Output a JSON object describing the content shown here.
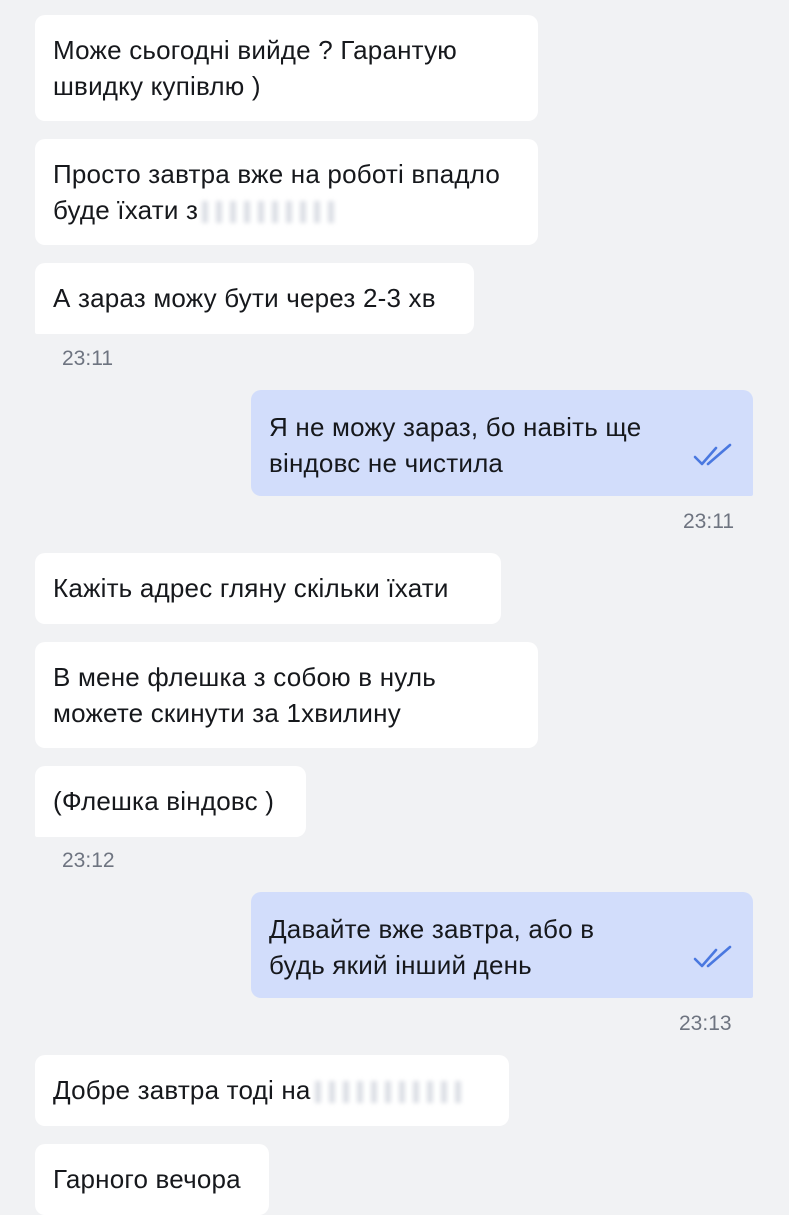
{
  "messages": {
    "m1": "Може сьогодні вийде ? Гарантую швидку купівлю )",
    "m2": "Просто завтра вже на роботі впадло буде їхати з",
    "m3": "А зараз можу бути через 2-3 хв",
    "t1": "23:11",
    "m4": "Я не можу зараз, бо навіть ще віндовс не чистила",
    "t2": "23:11",
    "m5": "Кажіть адрес гляну скільки їхати",
    "m6": "В мене флешка з собою в нуль можете скинути за 1хвилину",
    "m7": "(Флешка віндовс )",
    "t3": "23:12",
    "m8": "Давайте вже завтра, або в будь який інший день",
    "t4": "23:13",
    "m9": "Добре завтра тоді на",
    "m10": "Гарного вечора"
  },
  "icons": {
    "read_receipt": "double-check-icon"
  },
  "colors": {
    "background": "#f1f2f4",
    "incoming": "#ffffff",
    "outgoing": "#d2ddfb",
    "check": "#4a78e0",
    "time": "#6e7480"
  }
}
